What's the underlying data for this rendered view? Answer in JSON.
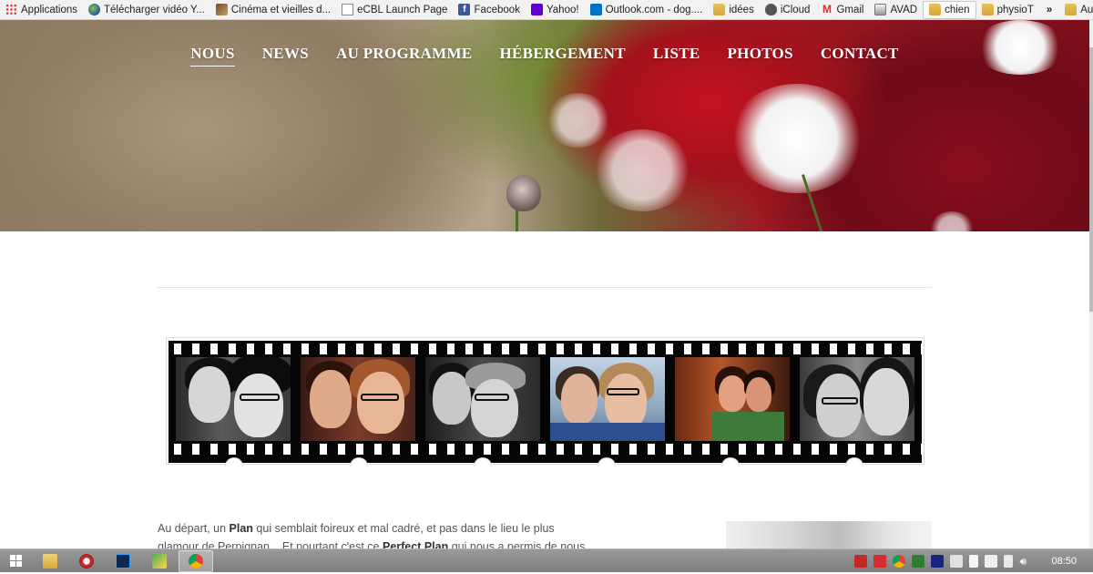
{
  "bookmarks": [
    {
      "label": "Applications",
      "icon": "apps-grid-icon"
    },
    {
      "label": "Télécharger vidéo Y...",
      "icon": "globe-icon"
    },
    {
      "label": "Cinéma et vieilles d...",
      "icon": "photo-icon"
    },
    {
      "label": "eCBL Launch Page",
      "icon": "page-icon"
    },
    {
      "label": "Facebook",
      "icon": "facebook-icon"
    },
    {
      "label": "Yahoo!",
      "icon": "yahoo-icon"
    },
    {
      "label": "Outlook.com - dog....",
      "icon": "outlook-icon"
    },
    {
      "label": "idées",
      "icon": "folder-icon"
    },
    {
      "label": "iCloud",
      "icon": "apple-icon"
    },
    {
      "label": "Gmail",
      "icon": "gmail-icon"
    },
    {
      "label": "AVAD",
      "icon": "avad-icon"
    },
    {
      "label": "chien",
      "icon": "folder-icon"
    },
    {
      "label": "physioT",
      "icon": "folder-icon"
    },
    {
      "label": "»",
      "icon": ""
    },
    {
      "label": "Autres favoris",
      "icon": "folder-icon"
    }
  ],
  "nav": {
    "items": [
      "NOUS",
      "NEWS",
      "AU PROGRAMME",
      "HÉBERGEMENT",
      "LISTE",
      "PHOTOS",
      "CONTACT"
    ],
    "active": "NOUS"
  },
  "content": {
    "intro_part1": "Au départ, un ",
    "intro_bold1": "Plan",
    "intro_part2": " qui semblait foireux et mal cadré, et pas dans le lieu le plus glamour de Perpignan... Et pourtant c'est ce ",
    "intro_bold2": "Perfect Plan",
    "intro_part3": " qui nous a permis de nous rencontrer et"
  },
  "taskbar": {
    "clock": "08:50"
  },
  "colors": {
    "accent_red": "#c41222",
    "nav_text": "#ffffff",
    "body_text": "#555555"
  }
}
